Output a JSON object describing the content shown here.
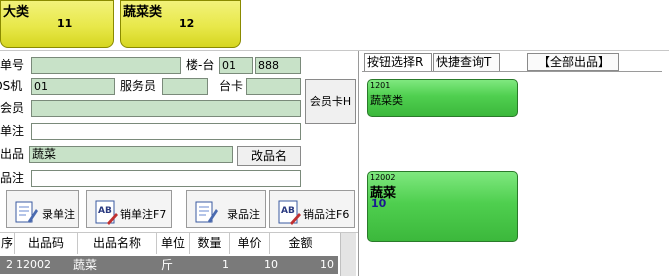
{
  "categories": [
    {
      "name": "大类",
      "count": "11"
    },
    {
      "name": "蔬菜类",
      "count": "12"
    }
  ],
  "form": {
    "order_no_label": "单号",
    "order_no_value": "",
    "floor_table_label": "楼-台",
    "floor_value": "01",
    "table_value": "888",
    "pos_label": "POS机",
    "pos_value": "01",
    "waiter_label": "服务员",
    "waiter_value": "",
    "card_label": "台卡",
    "card_value": "",
    "member_label": "会员",
    "member_value": "",
    "member_card_button": "会员卡H",
    "order_note_label": "单注",
    "order_note_value": "",
    "item_label": "出品",
    "item_value": "蔬菜",
    "rename_button": "改品名",
    "item_note_label": "品注",
    "item_note_value": ""
  },
  "actions": {
    "record_order_note": "录单注",
    "cancel_order_note": "销单注F7",
    "record_item_note": "录品注",
    "cancel_item_note": "销品注F6"
  },
  "tabs": {
    "button_select": "按钮选择R",
    "quick_query": "快捷查询T",
    "all_items": "【全部出品】"
  },
  "menu_buttons": [
    {
      "code": "1201",
      "name": "蔬菜类",
      "price": ""
    },
    {
      "code": "12002",
      "name": "蔬菜",
      "price": "10"
    }
  ],
  "table": {
    "columns": [
      "序",
      "出品码",
      "出品名称",
      "单位",
      "数量",
      "单价",
      "金额"
    ],
    "rows": [
      {
        "seq": "2",
        "code": "12002",
        "name": "蔬菜",
        "unit": "斤",
        "qty": "1",
        "price": "10",
        "amount": "10"
      }
    ]
  },
  "colors": {
    "category_yellow": "#e8e84a",
    "item_green": "#4fcf4f",
    "field_green": "#c8e2c8",
    "row_selected": "#7a7a7a"
  }
}
